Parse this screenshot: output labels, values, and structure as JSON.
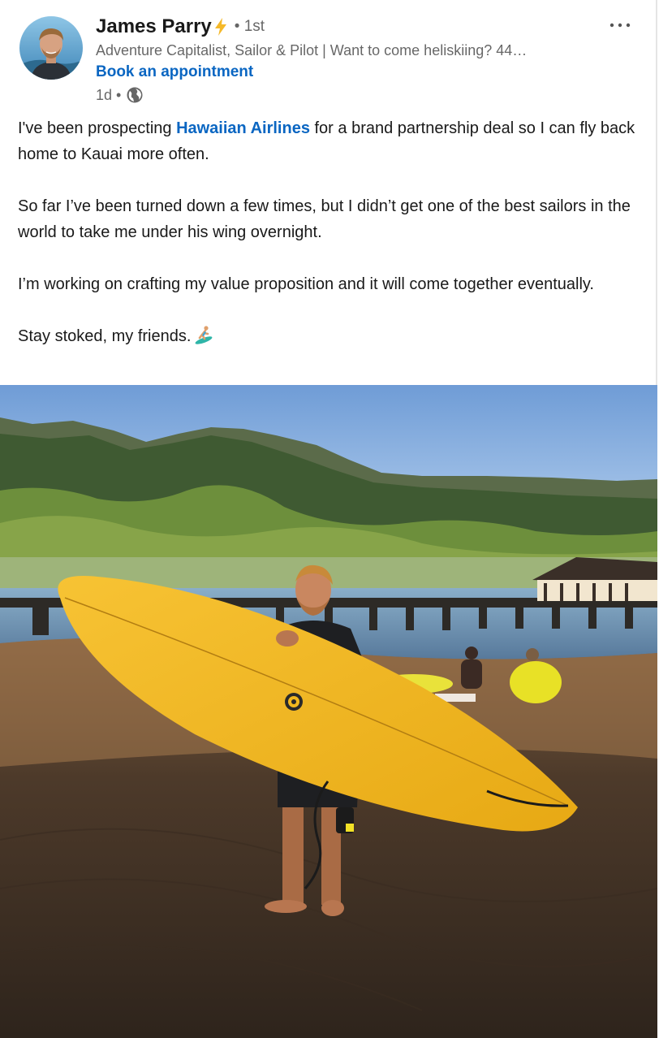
{
  "author": {
    "name": "James Parry",
    "degree": "• 1st",
    "headline": "Adventure Capitalist, Sailor & Pilot | Want to come heliskiing? 44…",
    "cta_label": "Book an appointment",
    "time": "1d •"
  },
  "post": {
    "p1_before": "I've been prospecting ",
    "p1_mention": "Hawaiian Airlines",
    "p1_after": " for a brand partnership deal so I can fly back home to Kauai more often.",
    "p2": "So far I’ve been turned down a few times, but I didn’t get one of the best sailors in the world to take me under his wing overnight.",
    "p3": "I’m working on crafting my value proposition and it will come together eventually.",
    "p4": "Stay stoked, my friends."
  },
  "icons": {
    "name_badge": "lightning-bolt-icon",
    "visibility": "globe-icon",
    "menu": "more-options-icon",
    "emoji": "surfer-emoji-icon"
  },
  "colors": {
    "link": "#0a66c2",
    "bolt": "#f5b92a",
    "surfboard": "#f2b81f"
  }
}
